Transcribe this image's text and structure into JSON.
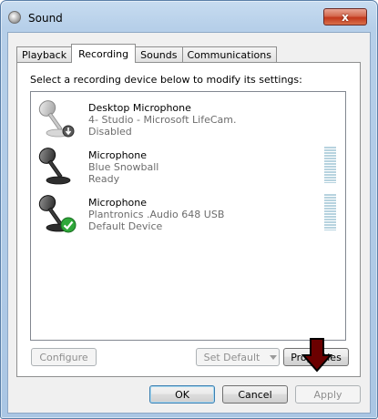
{
  "window": {
    "title": "Sound",
    "close_symbol": "x"
  },
  "tabs": [
    {
      "label": "Playback",
      "active": false
    },
    {
      "label": "Recording",
      "active": true
    },
    {
      "label": "Sounds",
      "active": false
    },
    {
      "label": "Communications",
      "active": false
    }
  ],
  "recording": {
    "instruction": "Select a recording device below to modify its settings:",
    "devices": [
      {
        "name": "Desktop Microphone",
        "description": "4- Studio - Microsoft LifeCam.",
        "status": "Disabled",
        "badge": "disabled-badge-icon"
      },
      {
        "name": "Microphone",
        "description": "Blue Snowball",
        "status": "Ready",
        "badge": "none"
      },
      {
        "name": "Microphone",
        "description": "Plantronics .Audio 648 USB",
        "status": "Default Device",
        "badge": "default-check-icon"
      }
    ],
    "configure_label": "Configure",
    "set_default_label": "Set Default",
    "properties_label": "Properties"
  },
  "footer": {
    "ok_label": "OK",
    "cancel_label": "Cancel",
    "apply_label": "Apply"
  },
  "colors": {
    "arrow": "#6b0000",
    "level_meter": "#b7d3df",
    "check_green": "#2fa83a"
  }
}
